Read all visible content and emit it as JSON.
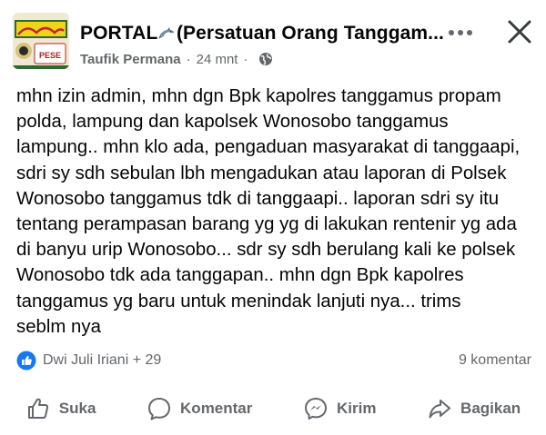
{
  "header": {
    "group_name": "PORTAL",
    "group_name_rest": "(Persatuan Orang Tanggam...",
    "author": "Taufik Permana",
    "separator": "·",
    "time": "24 mnt",
    "separator2": "·",
    "avatar_text": "PESE"
  },
  "post": {
    "text": "mhn izin admin, mhn dgn Bpk kapolres tanggamus propam\npolda, lampung dan kapolsek Wonosobo tanggamus\nlampung.. mhn klo ada, pengaduan masyarakat di tanggaapi,\nsdri sy sdh sebulan lbh mengadukan atau laporan di Polsek\nWonosobo tanggamus tdk di tanggaapi.. laporan sdri sy itu\ntentang perampasan barang yg yg di lakukan rentenir yg ada\ndi banyu urip Wonosobo... sdr sy sdh berulang kali ke polsek\nWonosobo tdk ada tanggapan.. mhn dgn Bpk kapolres\ntanggamus yg baru untuk menindak lanjuti nya... trims\nseblm nya"
  },
  "reactions": {
    "summary": "Dwi Juli Iriani + 29",
    "comments": "9 komentar"
  },
  "actions": {
    "like": "Suka",
    "comment": "Komentar",
    "send": "Kirim",
    "share": "Bagikan"
  },
  "colors": {
    "text": "#050505",
    "secondary": "#65676b",
    "like_blue": "#1877f2"
  },
  "icons": [
    "more-icon",
    "close-icon",
    "globe-icon",
    "like-badge-icon",
    "thumbs-up-icon",
    "comment-icon",
    "messenger-icon",
    "share-icon"
  ]
}
